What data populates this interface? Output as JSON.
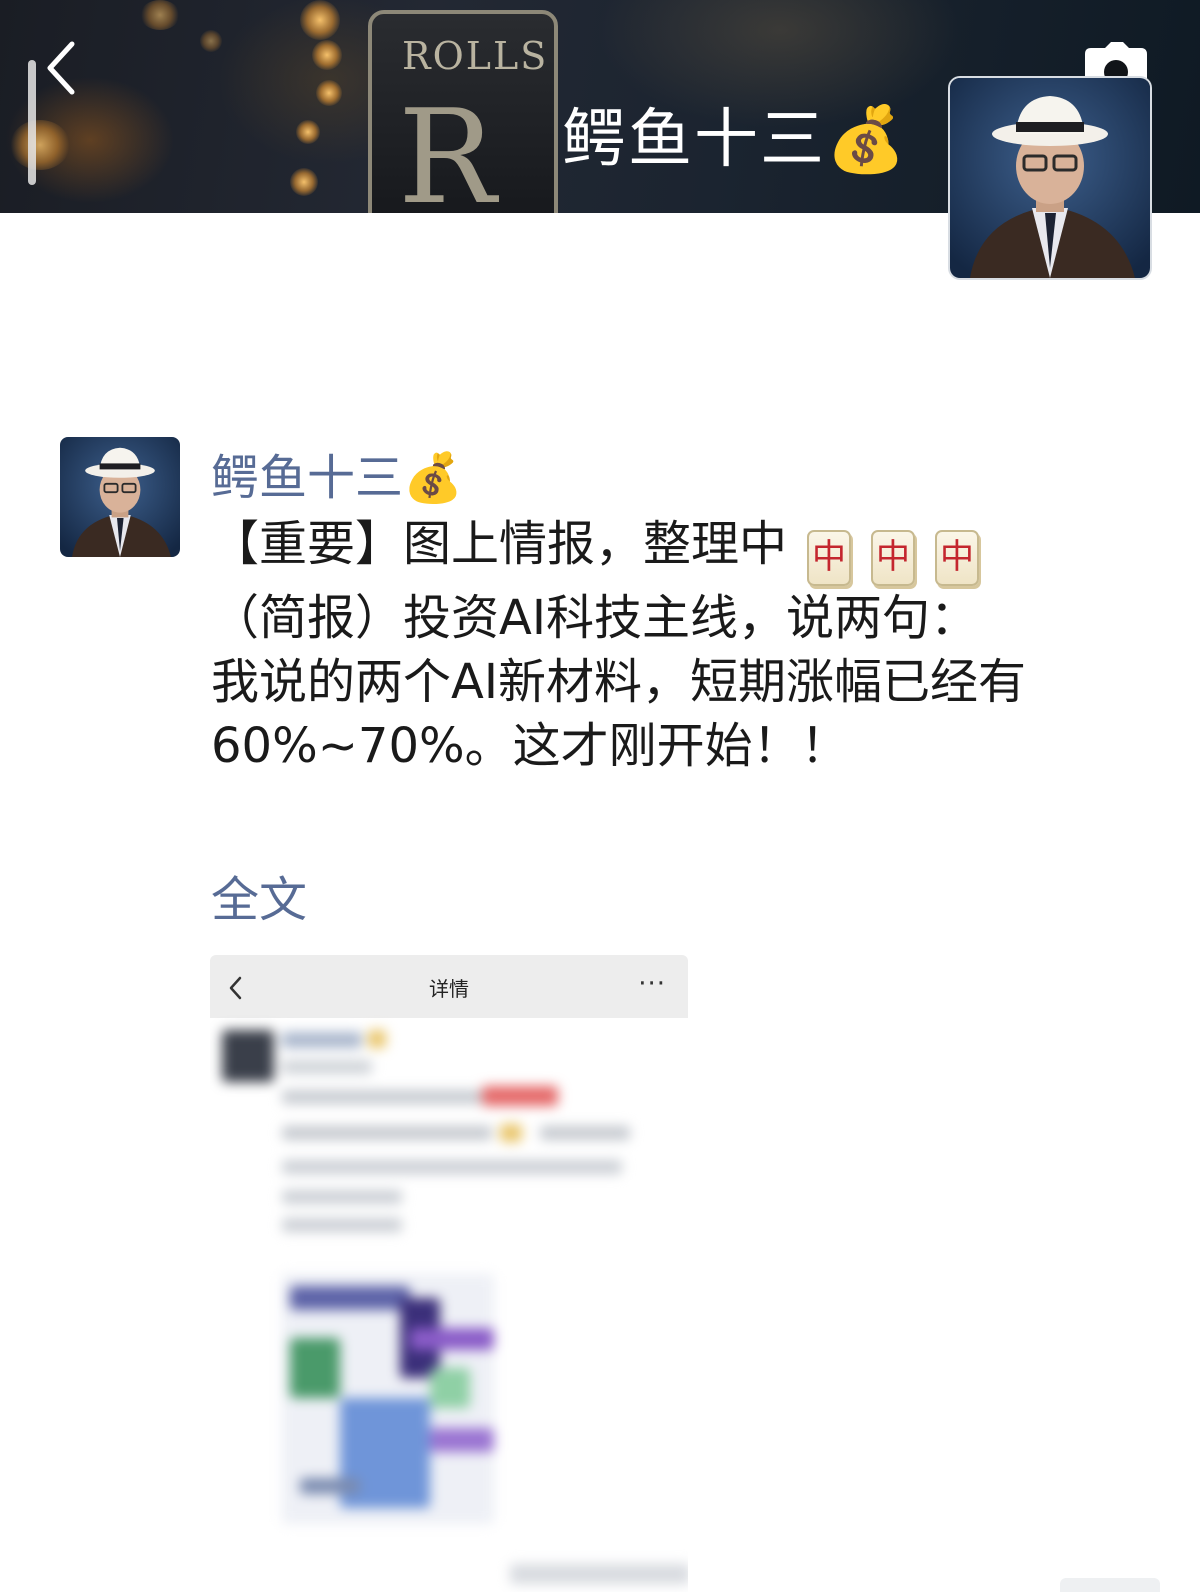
{
  "cover": {
    "name": "鳄鱼十三💰",
    "badge_word": "ROLLS",
    "badge_logo": "R"
  },
  "post": {
    "author": "鳄鱼十三💰",
    "lines": [
      "【重要】图上情报，整理中",
      "（简报）投资AI科技主线，说两句：",
      "我说的两个AI新材料，短期涨幅已经有",
      "60%~70%。这才刚开始！！"
    ],
    "tile_char": "中",
    "full_text_link": "全文"
  },
  "embedded_screenshot": {
    "title": "详情",
    "more_label": "···"
  },
  "colors": {
    "link_blue": "#576b95",
    "tile_red": "#c4262e"
  },
  "icons": [
    "back-arrow-icon",
    "camera-icon",
    "mahjong-red-dragon-icon",
    "chevron-left-icon",
    "more-dots-icon"
  ]
}
